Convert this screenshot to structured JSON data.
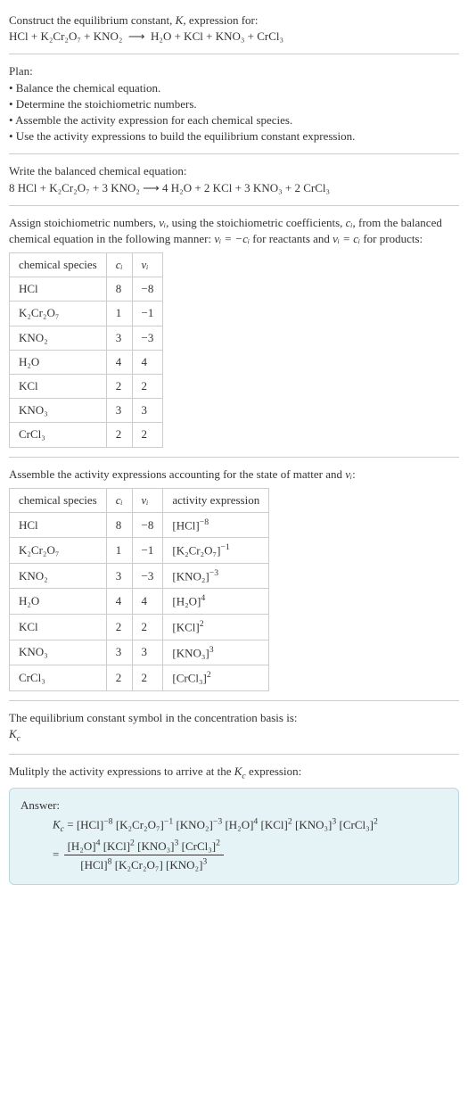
{
  "intro": {
    "line1_pre": "Construct the equilibrium constant, ",
    "line1_K": "K",
    "line1_post": ", expression for:",
    "eq_lhs": "HCl + K₂Cr₂O₇ + KNO₂",
    "eq_arrow": "⟶",
    "eq_rhs": "H₂O + KCl + KNO₃ + CrCl₃"
  },
  "plan": {
    "heading": "Plan:",
    "b1": "• Balance the chemical equation.",
    "b2": "• Determine the stoichiometric numbers.",
    "b3": "• Assemble the activity expression for each chemical species.",
    "b4": "• Use the activity expressions to build the equilibrium constant expression."
  },
  "balanced": {
    "heading": "Write the balanced chemical equation:",
    "eq": "8 HCl + K₂Cr₂O₇ + 3 KNO₂  ⟶  4 H₂O + 2 KCl + 3 KNO₃ + 2 CrCl₃"
  },
  "assign": {
    "p1a": "Assign stoichiometric numbers, ",
    "nu_i": "νᵢ",
    "p1b": ", using the stoichiometric coefficients, ",
    "c_i": "cᵢ",
    "p1c": ", from the balanced chemical equation in the following manner: ",
    "rel1": "νᵢ = −cᵢ",
    "p1d": " for reactants and ",
    "rel2": "νᵢ = cᵢ",
    "p1e": " for products:"
  },
  "table1": {
    "h1": "chemical species",
    "h2": "cᵢ",
    "h3": "νᵢ",
    "rows": [
      {
        "sp": "HCl",
        "c": "8",
        "v": "−8"
      },
      {
        "sp": "K₂Cr₂O₇",
        "c": "1",
        "v": "−1"
      },
      {
        "sp": "KNO₂",
        "c": "3",
        "v": "−3"
      },
      {
        "sp": "H₂O",
        "c": "4",
        "v": "4"
      },
      {
        "sp": "KCl",
        "c": "2",
        "v": "2"
      },
      {
        "sp": "KNO₃",
        "c": "3",
        "v": "3"
      },
      {
        "sp": "CrCl₃",
        "c": "2",
        "v": "2"
      }
    ]
  },
  "assemble": {
    "text_a": "Assemble the activity expressions accounting for the state of matter and ",
    "nu_i": "νᵢ",
    "text_b": ":"
  },
  "table2": {
    "h1": "chemical species",
    "h2": "cᵢ",
    "h3": "νᵢ",
    "h4": "activity expression",
    "rows": [
      {
        "sp": "HCl",
        "c": "8",
        "v": "−8",
        "a_base": "[HCl]",
        "a_exp": "−8"
      },
      {
        "sp": "K₂Cr₂O₇",
        "c": "1",
        "v": "−1",
        "a_base": "[K₂Cr₂O₇]",
        "a_exp": "−1"
      },
      {
        "sp": "KNO₂",
        "c": "3",
        "v": "−3",
        "a_base": "[KNO₂]",
        "a_exp": "−3"
      },
      {
        "sp": "H₂O",
        "c": "4",
        "v": "4",
        "a_base": "[H₂O]",
        "a_exp": "4"
      },
      {
        "sp": "KCl",
        "c": "2",
        "v": "2",
        "a_base": "[KCl]",
        "a_exp": "2"
      },
      {
        "sp": "KNO₃",
        "c": "3",
        "v": "3",
        "a_base": "[KNO₃]",
        "a_exp": "3"
      },
      {
        "sp": "CrCl₃",
        "c": "2",
        "v": "2",
        "a_base": "[CrCl₃]",
        "a_exp": "2"
      }
    ]
  },
  "symbol": {
    "line1": "The equilibrium constant symbol in the concentration basis is:",
    "Kc_K": "K",
    "Kc_c": "c"
  },
  "multiply": {
    "text_a": "Mulitply the activity expressions to arrive at the ",
    "Kc_K": "K",
    "Kc_c": "c",
    "text_b": " expression:"
  },
  "answer": {
    "label": "Answer:",
    "lhs_K": "K",
    "lhs_c": "c",
    "eq": " = ",
    "prod": {
      "t1b": "[HCl]",
      "t1e": "−8",
      "t2b": "[K₂Cr₂O₇]",
      "t2e": "−1",
      "t3b": "[KNO₂]",
      "t3e": "−3",
      "t4b": "[H₂O]",
      "t4e": "4",
      "t5b": "[KCl]",
      "t5e": "2",
      "t6b": "[KNO₃]",
      "t6e": "3",
      "t7b": "[CrCl₃]",
      "t7e": "2"
    },
    "eq2": " = ",
    "frac": {
      "n1b": "[H₂O]",
      "n1e": "4",
      "n2b": "[KCl]",
      "n2e": "2",
      "n3b": "[KNO₃]",
      "n3e": "3",
      "n4b": "[CrCl₃]",
      "n4e": "2",
      "d1b": "[HCl]",
      "d1e": "8",
      "d2b": "[K₂Cr₂O₇]",
      "d2e": "",
      "d3b": "[KNO₂]",
      "d3e": "3"
    }
  }
}
